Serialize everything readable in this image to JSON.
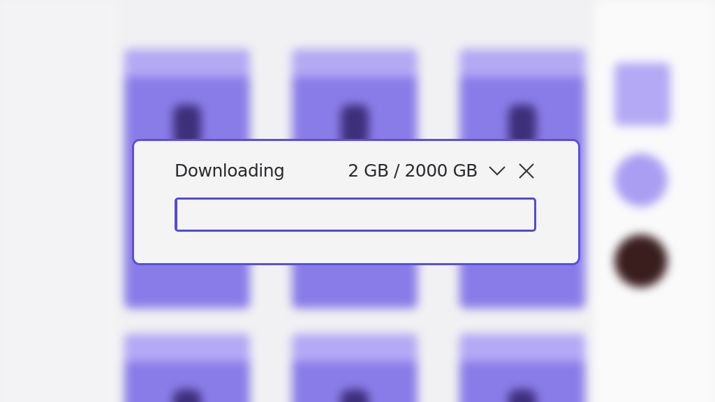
{
  "download_dialog": {
    "title": "Downloading",
    "progress_text": "2 GB / 2000 GB",
    "progress": {
      "level": 0.001
    }
  }
}
